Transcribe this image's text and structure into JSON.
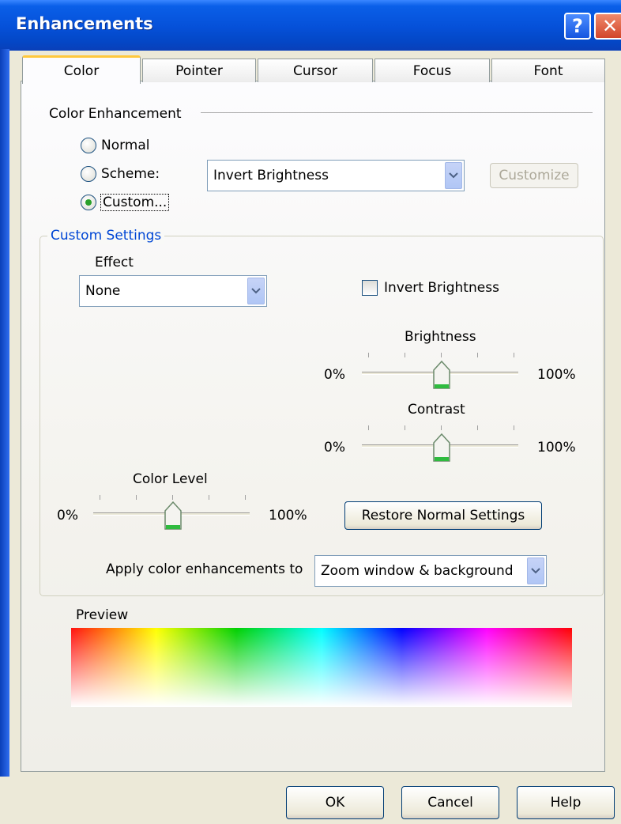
{
  "window": {
    "title": "Enhancements",
    "help_glyph": "?",
    "close_glyph": "✕"
  },
  "tabs": [
    {
      "label": "Color",
      "active": true
    },
    {
      "label": "Pointer",
      "active": false
    },
    {
      "label": "Cursor",
      "active": false
    },
    {
      "label": "Focus",
      "active": false
    },
    {
      "label": "Font",
      "active": false
    }
  ],
  "color_enhancement": {
    "heading": "Color Enhancement",
    "options": [
      {
        "label": "Normal",
        "selected": false
      },
      {
        "label": "Scheme:",
        "selected": false
      },
      {
        "label": "Custom...",
        "selected": true
      }
    ],
    "scheme_value": "Invert Brightness",
    "customize_label": "Customize"
  },
  "custom_settings": {
    "group_label": "Custom Settings",
    "effect_label": "Effect",
    "effect_value": "None",
    "invert_brightness_label": "Invert Brightness",
    "invert_brightness_checked": false,
    "brightness": {
      "label": "Brightness",
      "min_label": "0%",
      "max_label": "100%",
      "value": 50
    },
    "contrast": {
      "label": "Contrast",
      "min_label": "0%",
      "max_label": "100%",
      "value": 50
    },
    "color_level": {
      "label": "Color Level",
      "min_label": "0%",
      "max_label": "100%",
      "value": 50
    },
    "restore_label": "Restore Normal Settings",
    "apply_label": "Apply color enhancements to",
    "apply_value": "Zoom window & background"
  },
  "preview": {
    "label": "Preview"
  },
  "footer": {
    "ok_label": "OK",
    "cancel_label": "Cancel",
    "help_label": "Help"
  },
  "colors": {
    "titlebar": "#0550d8",
    "accent_tab": "#ffc83c",
    "group_label": "#0046d5",
    "radio_dot": "#2aa02a"
  }
}
